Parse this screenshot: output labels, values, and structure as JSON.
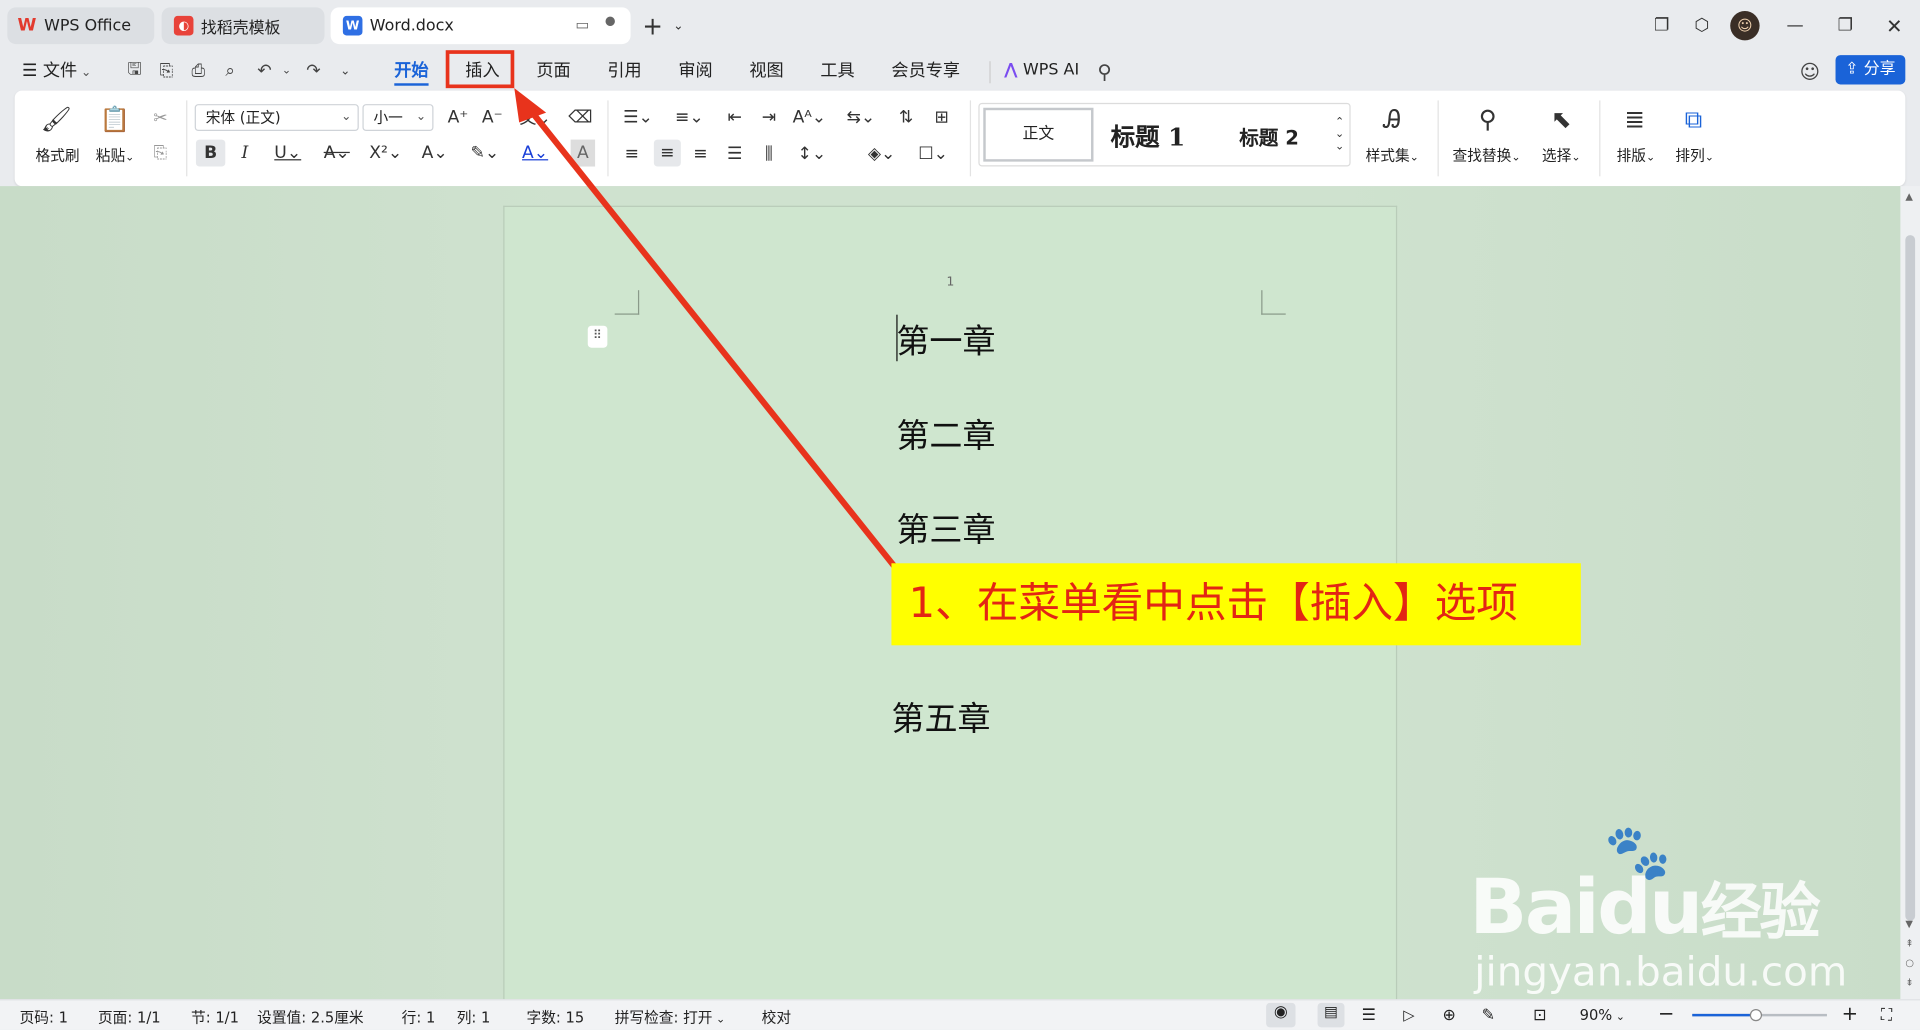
{
  "tabs": [
    {
      "label": "WPS Office",
      "icon": "wps-logo-icon"
    },
    {
      "label": "找稻壳模板",
      "icon": "docer-icon"
    },
    {
      "label": "Word.docx",
      "icon": "word-doc-icon"
    }
  ],
  "menu": {
    "file": "文件",
    "items": [
      "开始",
      "插入",
      "页面",
      "引用",
      "审阅",
      "视图",
      "工具",
      "会员专享"
    ],
    "wps_ai": "WPS AI",
    "share": "分享"
  },
  "ribbon": {
    "format_painter": "格式刷",
    "paste": "粘贴",
    "font_name": "宋体 (正文)",
    "font_size": "小一",
    "styles": [
      "正文",
      "标题 1",
      "标题 2"
    ],
    "style_set": "样式集",
    "find_replace": "查找替换",
    "select": "选择",
    "layout": "排版",
    "arrange": "排列"
  },
  "document": {
    "page_number": "1",
    "chapters": [
      "第一章",
      "第二章",
      "第三章",
      "第五章"
    ]
  },
  "annotation": {
    "callout": "1、在菜单看中点击【插入】选项",
    "watermark_main": "Bai",
    "watermark_du": "du",
    "watermark_cn": "经验",
    "watermark_url": "jingyan.baidu.com"
  },
  "status": {
    "page": "页码: 1",
    "pages": "页面: 1/1",
    "section": "节: 1/1",
    "setting": "设置值: 2.5厘米",
    "row": "行: 1",
    "col": "列: 1",
    "words": "字数: 15",
    "spell": "拼写检查: 打开",
    "proof": "校对",
    "zoom": "90%",
    "zoom_level": 0.47
  },
  "colors": {
    "accent": "#1a63d8",
    "annotation_red": "#e8331c",
    "callout_bg": "#ffff00"
  }
}
